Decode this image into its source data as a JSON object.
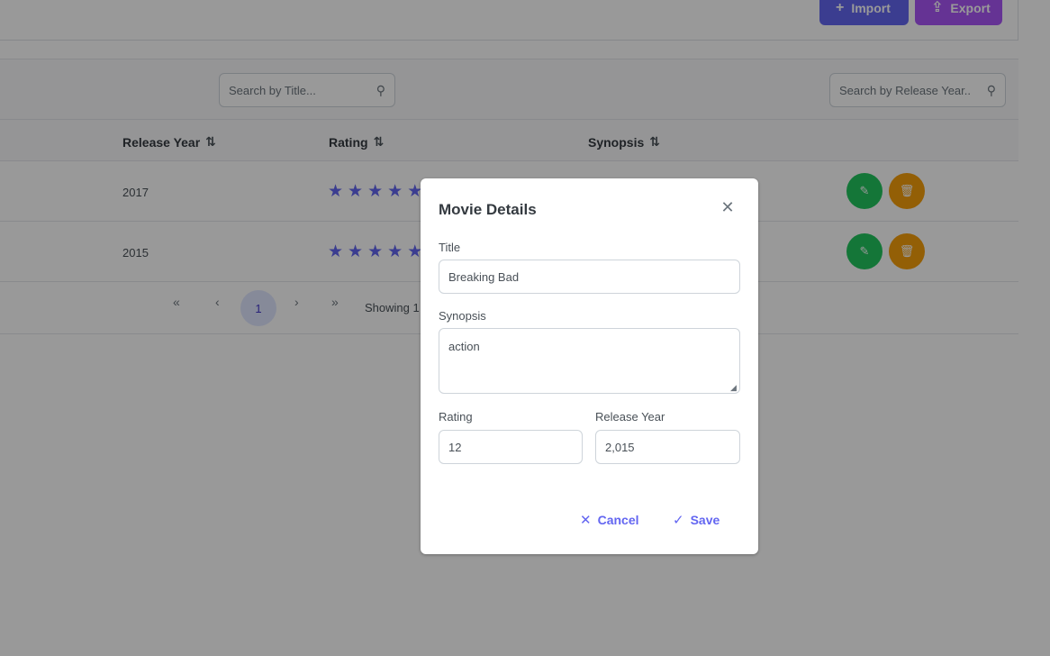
{
  "toolbar": {
    "import_label": "Import",
    "export_label": "Export",
    "import_icon": "plus-icon",
    "export_icon": "upload-icon"
  },
  "filters": {
    "title_placeholder": "Search by Title...",
    "year_placeholder": "Search by Release Year.."
  },
  "table": {
    "columns": [
      "Release Year",
      "Rating",
      "Synopsis"
    ],
    "rows": [
      {
        "release_year": "2017",
        "rating": 5
      },
      {
        "release_year": "2015",
        "rating": 5
      }
    ]
  },
  "paginator": {
    "current_page": "1",
    "report": "Showing 1"
  },
  "dialog": {
    "title": "Movie Details",
    "title_label": "Title",
    "title_value": "Breaking Bad",
    "synopsis_label": "Synopsis",
    "synopsis_value": "action",
    "rating_label": "Rating",
    "rating_value": "12",
    "year_label": "Release Year",
    "year_value": "2,015",
    "cancel_label": "Cancel",
    "save_label": "Save"
  },
  "colors": {
    "primary": "#6366f1",
    "export": "#a855f7",
    "edit": "#22c55e",
    "delete": "#f59e0b"
  }
}
